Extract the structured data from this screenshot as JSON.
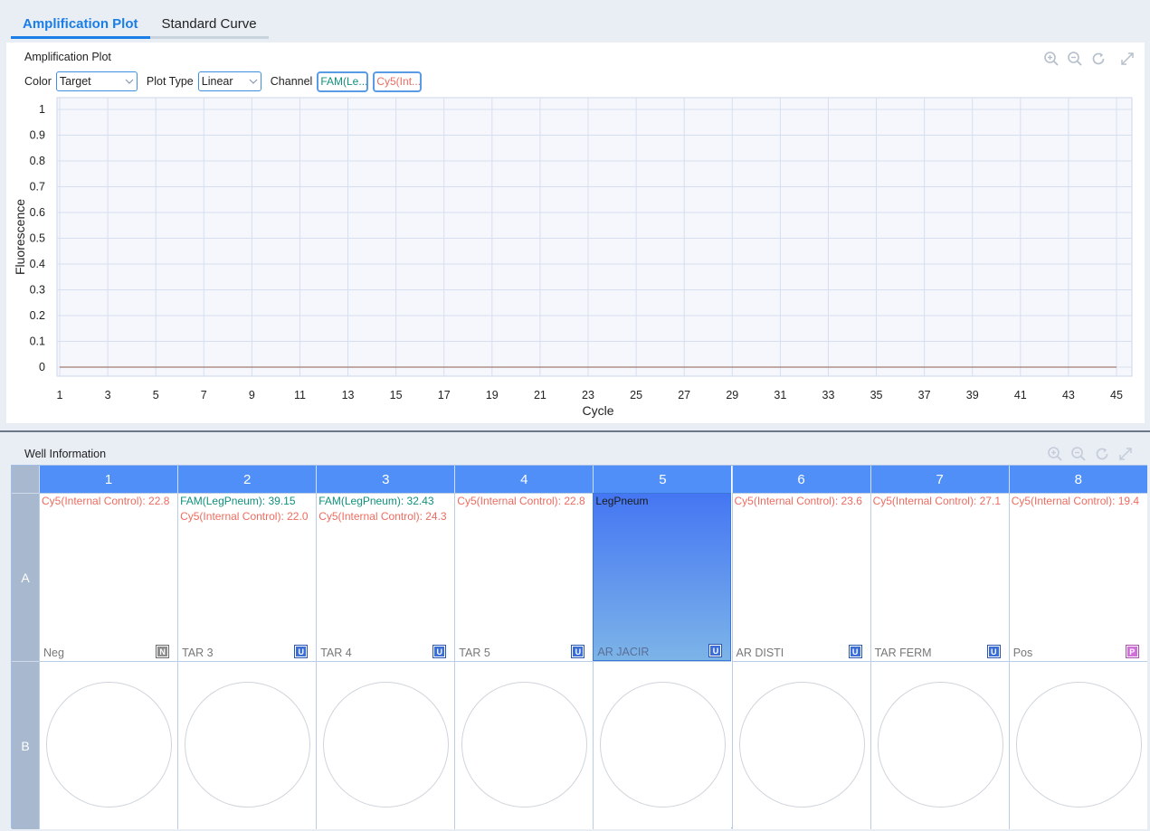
{
  "tabs": [
    "Amplification Plot",
    "Standard Curve"
  ],
  "plot": {
    "title": "Amplification Plot",
    "color_label": "Color",
    "color_value": "Target",
    "plot_type_label": "Plot Type",
    "plot_type_value": "Linear",
    "channel_label": "Channel",
    "channels": [
      {
        "label": "FAM(Le...",
        "color": "#10907d"
      },
      {
        "label": "Cy5(Int...",
        "color": "#ed6c60"
      }
    ],
    "tool_icons": [
      "zoom-in-icon",
      "zoom-out-icon",
      "refresh-icon",
      "expand-icon"
    ]
  },
  "chart_data": {
    "type": "line",
    "xlabel": "Cycle",
    "ylabel": "Fluorescence",
    "x_ticks": [
      1,
      3,
      5,
      7,
      9,
      11,
      13,
      15,
      17,
      19,
      21,
      23,
      25,
      27,
      29,
      31,
      33,
      35,
      37,
      39,
      41,
      43,
      45
    ],
    "y_ticks": [
      "1",
      "0.9",
      "0.8",
      "0.7",
      "0.6",
      "0.5",
      "0.4",
      "0.3",
      "0.2",
      "0.1",
      "0"
    ],
    "xlim": [
      1,
      45
    ],
    "ylim": [
      0,
      1
    ],
    "grid": true,
    "series": [
      {
        "color": "#b08f86",
        "x": [
          1,
          45
        ],
        "y": [
          0,
          0
        ]
      }
    ]
  },
  "wells": {
    "title": "Well Information",
    "columns": [
      "1",
      "2",
      "3",
      "4",
      "5",
      "6",
      "7",
      "8"
    ],
    "rows": [
      "A",
      "B"
    ],
    "row_a": [
      {
        "lines": [
          {
            "text": "Cy5(Internal Control): 22.8",
            "kind": "cy5"
          }
        ],
        "name": "Neg",
        "badge": "N",
        "badge_kind": "n",
        "selected": false
      },
      {
        "lines": [
          {
            "text": "FAM(LegPneum): 39.15",
            "kind": "fam"
          },
          {
            "text": "Cy5(Internal Control): 22.0",
            "kind": "cy5"
          }
        ],
        "name": "TAR 3",
        "badge": "U",
        "badge_kind": "u",
        "selected": false
      },
      {
        "lines": [
          {
            "text": "FAM(LegPneum): 32.43",
            "kind": "fam"
          },
          {
            "text": "Cy5(Internal Control): 24.3",
            "kind": "cy5"
          }
        ],
        "name": "TAR 4",
        "badge": "U",
        "badge_kind": "u",
        "selected": false
      },
      {
        "lines": [
          {
            "text": "Cy5(Internal Control): 22.8",
            "kind": "cy5"
          }
        ],
        "name": "TAR 5",
        "badge": "U",
        "badge_kind": "u",
        "selected": false
      },
      {
        "lines": [
          {
            "text": "LegPneum",
            "kind": "target"
          }
        ],
        "name": "AR JACIR",
        "badge": "U",
        "badge_kind": "u",
        "selected": true
      },
      {
        "lines": [
          {
            "text": "Cy5(Internal Control): 23.6",
            "kind": "cy5"
          }
        ],
        "name": "AR DISTI",
        "badge": "U",
        "badge_kind": "u",
        "selected": false
      },
      {
        "lines": [
          {
            "text": "Cy5(Internal Control): 27.1",
            "kind": "cy5"
          }
        ],
        "name": "TAR FERM",
        "badge": "U",
        "badge_kind": "u",
        "selected": false
      },
      {
        "lines": [
          {
            "text": "Cy5(Internal Control): 19.4",
            "kind": "cy5"
          }
        ],
        "name": "Pos",
        "badge": "P",
        "badge_kind": "p",
        "selected": false
      }
    ]
  }
}
